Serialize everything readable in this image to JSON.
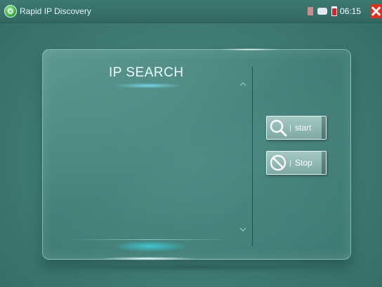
{
  "titlebar": {
    "title": "Rapid IP Discovery",
    "app_icon": "green-circle-app-icon"
  },
  "status_bar": {
    "icons": [
      "sd-card-icon",
      "network-icon",
      "battery-icon"
    ],
    "time": "06:15",
    "close_icon": "close-icon"
  },
  "panel": {
    "heading": "IP SEARCH",
    "scroll_up_glyph": "^",
    "scroll_down_glyph": "v"
  },
  "buttons": {
    "start": {
      "label": "start",
      "icon": "magnifier-icon"
    },
    "stop": {
      "label": "Stop",
      "icon": "stop-icon"
    }
  },
  "colors": {
    "background": "#3e7b73",
    "close": "#e0311f",
    "button": "#8fb7b1",
    "glow": "#3cdcf0"
  }
}
